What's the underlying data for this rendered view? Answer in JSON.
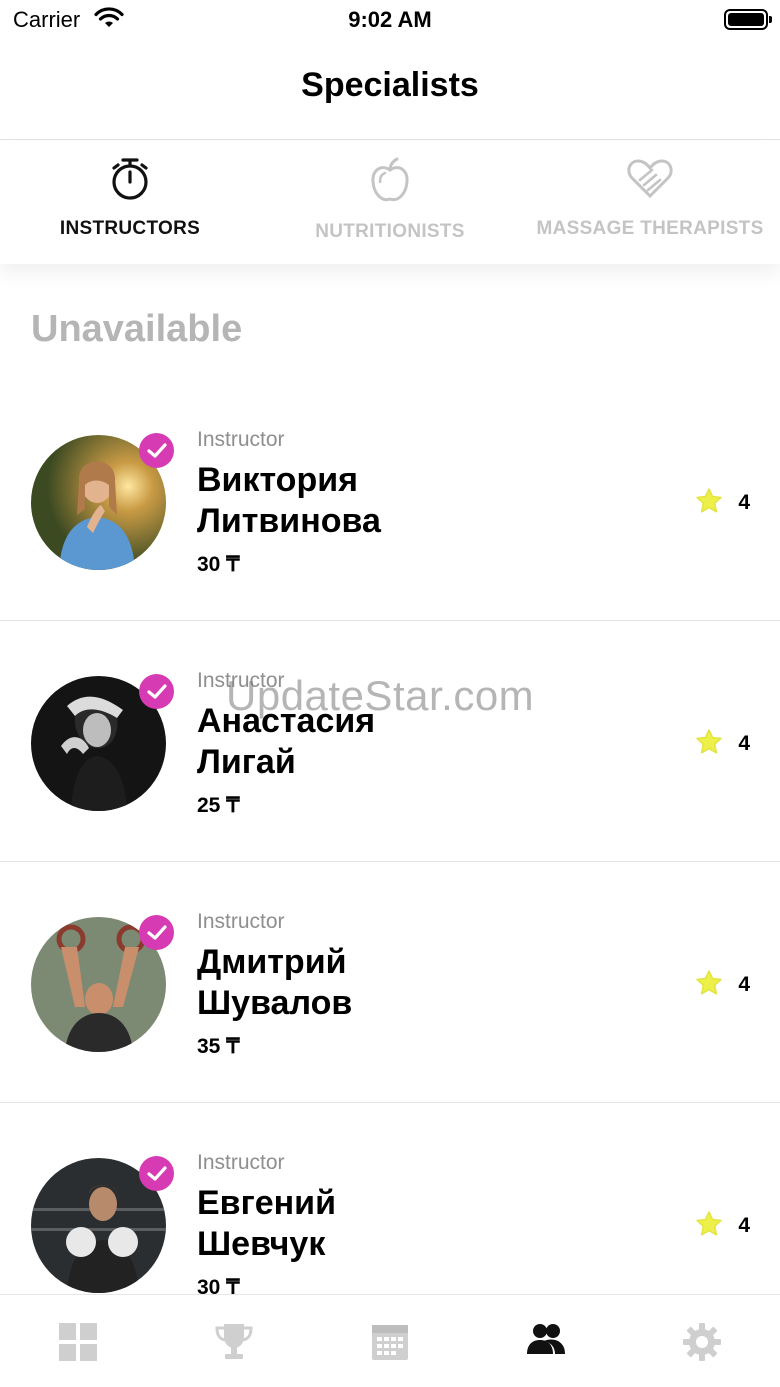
{
  "status_bar": {
    "carrier": "Carrier",
    "time": "9:02 AM"
  },
  "header": {
    "title": "Specialists"
  },
  "tabs": [
    {
      "label": "INSTRUCTORS",
      "icon": "stopwatch-icon",
      "active": true
    },
    {
      "label": "NUTRITIONISTS",
      "icon": "apple-icon",
      "active": false
    },
    {
      "label": "MASSAGE THERAPISTS",
      "icon": "heart-hand-icon",
      "active": false
    }
  ],
  "section": {
    "title": "Unavailable"
  },
  "specialists": [
    {
      "role": "Instructor",
      "name_line1": "Виктория",
      "name_line2": "Литвинова",
      "price": "30 ₸",
      "rating": "4"
    },
    {
      "role": "Instructor",
      "name_line1": "Анастасия",
      "name_line2": "Лигай",
      "price": "25 ₸",
      "rating": "4"
    },
    {
      "role": "Instructor",
      "name_line1": "Дмитрий",
      "name_line2": "Шувалов",
      "price": "35 ₸",
      "rating": "4"
    },
    {
      "role": "Instructor",
      "name_line1": "Евгений",
      "name_line2": "Шевчук",
      "price": "30 ₸",
      "rating": "4"
    }
  ],
  "watermark": "UpdateStar.com",
  "tab_bar": {
    "items": [
      "dashboard-icon",
      "trophy-icon",
      "calendar-icon",
      "specialists-icon",
      "settings-icon"
    ],
    "active_index": 3
  },
  "colors": {
    "accent_badge": "#d63bb3",
    "star": "#eef04a",
    "inactive": "#c4c4c4",
    "section_title": "#b5b5b5"
  }
}
